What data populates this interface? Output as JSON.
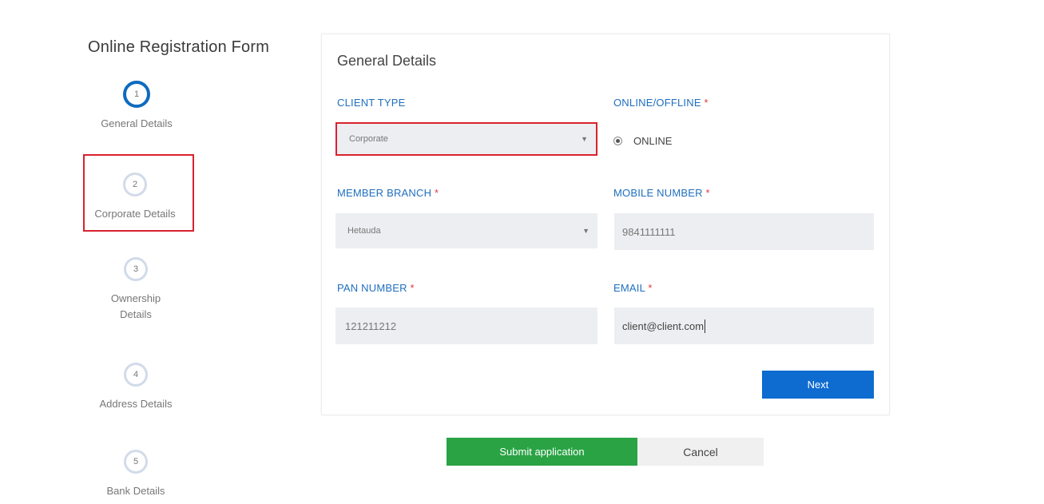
{
  "form_title": "Online Registration Form",
  "steps": [
    {
      "number": "1",
      "label": "General Details",
      "active": true
    },
    {
      "number": "2",
      "label": "Corporate Details",
      "active": false
    },
    {
      "number": "3",
      "label": "Ownership Details",
      "active": false
    },
    {
      "number": "4",
      "label": "Address Details",
      "active": false
    },
    {
      "number": "5",
      "label": "Bank Details",
      "active": false
    }
  ],
  "card": {
    "title": "General Details",
    "client_type": {
      "label": "CLIENT TYPE",
      "value": "Corporate"
    },
    "online_offline": {
      "label": "ONLINE/OFFLINE",
      "required_mark": "*",
      "option": "ONLINE"
    },
    "member_branch": {
      "label": "MEMBER BRANCH",
      "required_mark": "*",
      "value": "Hetauda"
    },
    "mobile_number": {
      "label": "MOBILE NUMBER",
      "required_mark": "*",
      "value": "9841111111"
    },
    "pan_number": {
      "label": "PAN NUMBER",
      "required_mark": "*",
      "value": "121211212"
    },
    "email": {
      "label": "EMAIL",
      "required_mark": "*",
      "value": "client@client.com"
    },
    "next_label": "Next"
  },
  "actions": {
    "submit_label": "Submit application",
    "cancel_label": "Cancel"
  },
  "colors": {
    "accent_blue": "#0e6bd0",
    "submit_green": "#2aa345",
    "highlight_red": "#d9222f",
    "label_blue": "#1f6fbf"
  },
  "icons": {
    "select_arrow": "dropdown-arrow-icon",
    "radio": "radio-selected-icon"
  }
}
